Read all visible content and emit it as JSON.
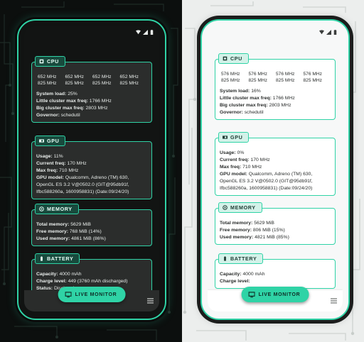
{
  "colors": {
    "accent": "#2fd3a6",
    "dark_card": "#2b2d2c",
    "light_card": "#ffffff"
  },
  "dark": {
    "cpu": {
      "title": "CPU",
      "freqs": [
        "652 MHz",
        "652 MHz",
        "652 MHz",
        "652 MHz",
        "825 MHz",
        "825 MHz",
        "825 MHz",
        "825 MHz"
      ],
      "system_load_label": "System load:",
      "system_load": "25%",
      "little_label": "Little cluster max freq:",
      "little": "1766 MHz",
      "big_label": "Big cluster max freq:",
      "big": "2803 MHz",
      "governor_label": "Governor:",
      "governor": "schedutil"
    },
    "gpu": {
      "title": "GPU",
      "usage_label": "Usage:",
      "usage": "11%",
      "current_label": "Current freq:",
      "current": "170 MHz",
      "max_label": "Max freq:",
      "max": "710 MHz",
      "model_label": "GPU model:",
      "model": "Qualcomm, Adreno (TM) 630, OpenGL ES 3.2 V@0502.0 (GIT@95db91f, Ifbc588260a, 1600958831) (Date:09/24/20)"
    },
    "memory": {
      "title": "MEMORY",
      "total_label": "Total memory:",
      "total": "5629 MiB",
      "free_label": "Free memory:",
      "free": "768 MiB (14%)",
      "used_label": "Used memory:",
      "used": "4861 MiB (86%)"
    },
    "battery": {
      "title": "BATTERY",
      "capacity_label": "Capacity:",
      "capacity": "4000 mAh",
      "charge_label": "Charge level:",
      "charge": "449 (3760 mAh discharged)",
      "status_label": "Status:",
      "status": "Discharging"
    },
    "fab_label": "LIVE MONITOR"
  },
  "light": {
    "cpu": {
      "title": "CPU",
      "freqs": [
        "576 MHz",
        "576 MHz",
        "576 MHz",
        "576 MHz",
        "825 MHz",
        "825 MHz",
        "825 MHz",
        "825 MHz"
      ],
      "system_load_label": "System load:",
      "system_load": "16%",
      "little_label": "Little cluster max freq:",
      "little": "1766 MHz",
      "big_label": "Big cluster max freq:",
      "big": "2803 MHz",
      "governor_label": "Governor:",
      "governor": "schedutil"
    },
    "gpu": {
      "title": "GPU",
      "usage_label": "Usage:",
      "usage": "0%",
      "current_label": "Current freq:",
      "current": "170 MHz",
      "max_label": "Max freq:",
      "max": "710 MHz",
      "model_label": "GPU model:",
      "model": "Qualcomm, Adreno (TM) 630, OpenGL ES 3.2 V@0502.0 (GIT@95db91f, Ifbc588260a, 1600958831) (Date:09/24/20)"
    },
    "memory": {
      "title": "MEMORY",
      "total_label": "Total memory:",
      "total": "5629 MiB",
      "free_label": "Free memory:",
      "free": "806 MiB (15%)",
      "used_label": "Used memory:",
      "used": "4821 MiB (85%)"
    },
    "battery": {
      "title": "BATTERY",
      "capacity_label": "Capacity:",
      "capacity": "4000 mAh",
      "charge_label": "Charge level:",
      "charge": "",
      "status_label": "",
      "status": ""
    },
    "fab_label": "LIVE MONITOR"
  }
}
